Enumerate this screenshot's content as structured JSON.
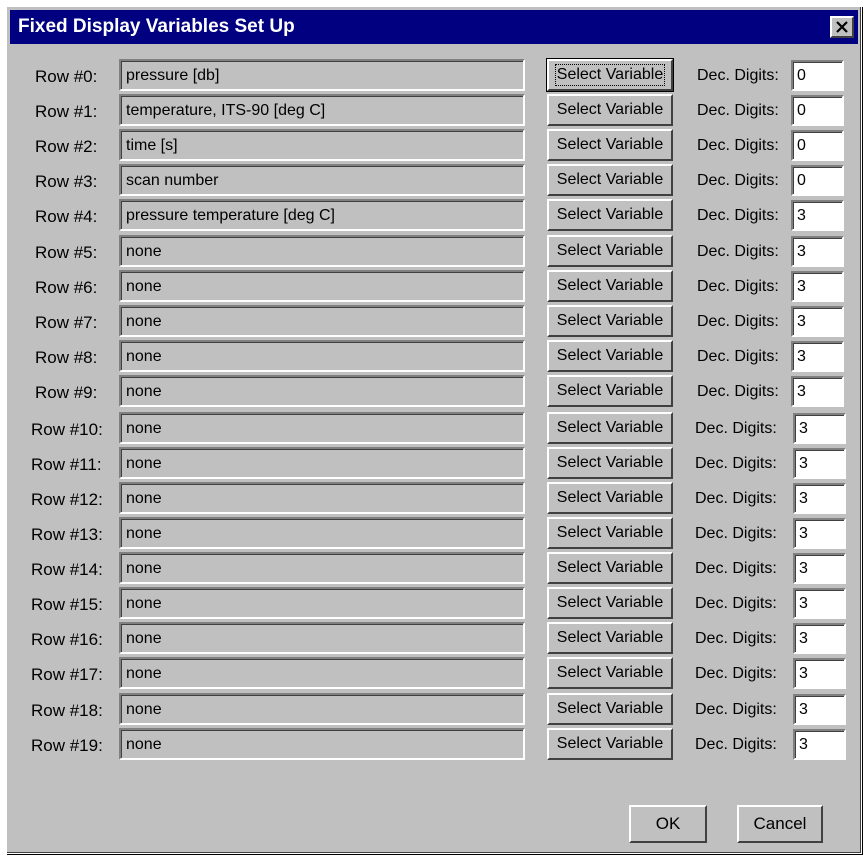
{
  "window": {
    "title": "Fixed Display Variables Set Up",
    "close_glyph": "×"
  },
  "select_label": "Select Variable",
  "dec_label": "Dec. Digits:",
  "rows": [
    {
      "label": "Row #0:",
      "variable": "pressure [db]",
      "digits": "0"
    },
    {
      "label": "Row #1:",
      "variable": "temperature, ITS-90 [deg C]",
      "digits": "0"
    },
    {
      "label": "Row #2:",
      "variable": "time [s]",
      "digits": "0"
    },
    {
      "label": "Row #3:",
      "variable": "scan number",
      "digits": "0"
    },
    {
      "label": "Row #4:",
      "variable": "pressure temperature [deg C]",
      "digits": "3"
    },
    {
      "label": "Row #5:",
      "variable": "none",
      "digits": "3"
    },
    {
      "label": "Row #6:",
      "variable": "none",
      "digits": "3"
    },
    {
      "label": "Row #7:",
      "variable": "none",
      "digits": "3"
    },
    {
      "label": "Row #8:",
      "variable": "none",
      "digits": "3"
    },
    {
      "label": "Row #9:",
      "variable": "none",
      "digits": "3"
    },
    {
      "label": "Row #10:",
      "variable": "none",
      "digits": "3"
    },
    {
      "label": "Row #11:",
      "variable": "none",
      "digits": "3"
    },
    {
      "label": "Row #12:",
      "variable": "none",
      "digits": "3"
    },
    {
      "label": "Row #13:",
      "variable": "none",
      "digits": "3"
    },
    {
      "label": "Row #14:",
      "variable": "none",
      "digits": "3"
    },
    {
      "label": "Row #15:",
      "variable": "none",
      "digits": "3"
    },
    {
      "label": "Row #16:",
      "variable": "none",
      "digits": "3"
    },
    {
      "label": "Row #17:",
      "variable": "none",
      "digits": "3"
    },
    {
      "label": "Row #18:",
      "variable": "none",
      "digits": "3"
    },
    {
      "label": "Row #19:",
      "variable": "none",
      "digits": "3"
    }
  ],
  "buttons": {
    "ok": "OK",
    "cancel": "Cancel"
  }
}
